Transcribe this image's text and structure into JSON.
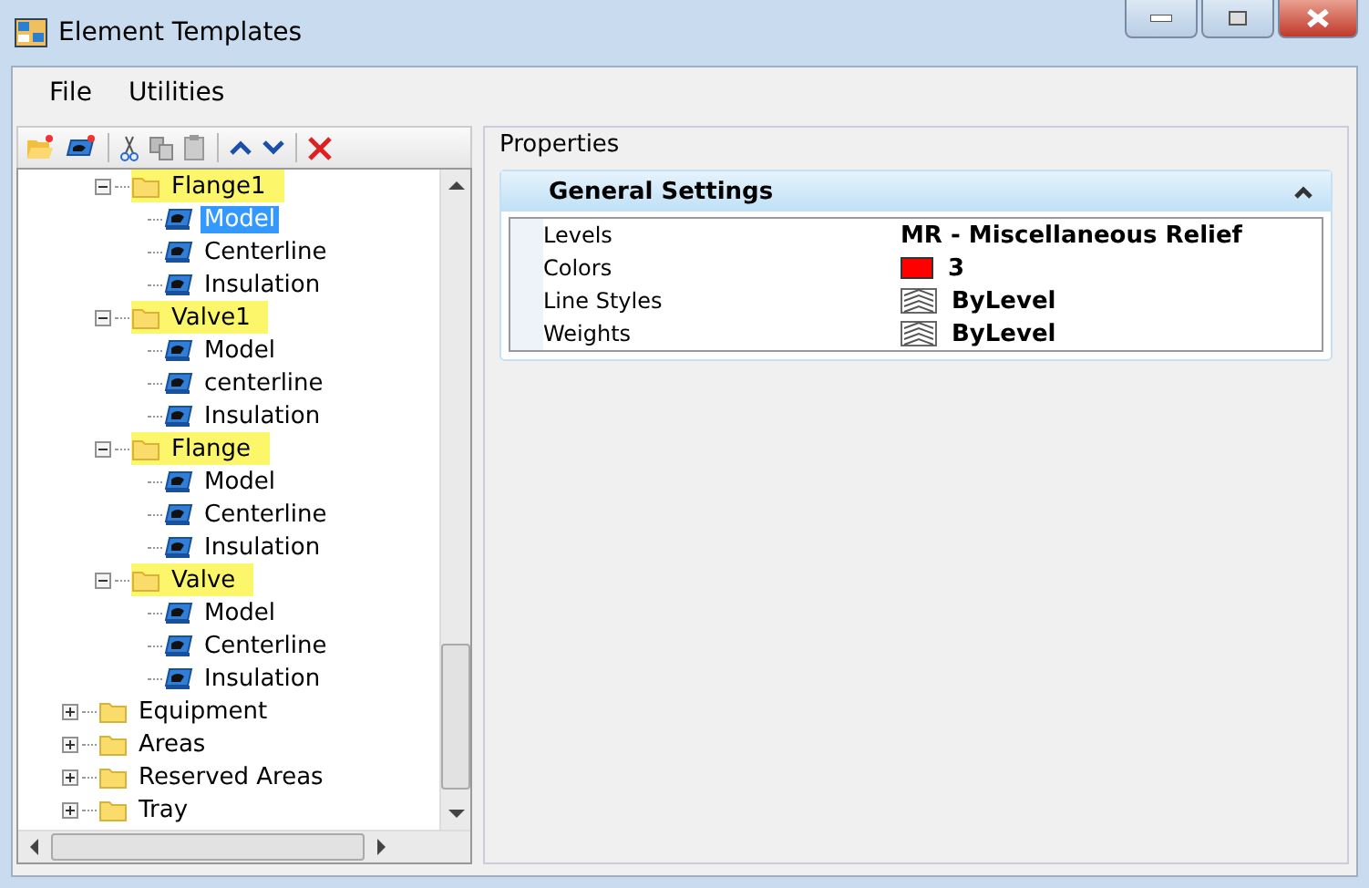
{
  "window": {
    "title": "Element Templates"
  },
  "menu": [
    "File",
    "Utilities"
  ],
  "tree": [
    {
      "children": [
        {
          "kind": "folder",
          "label": "Flange1",
          "highlighted": true,
          "expanded": true,
          "children": [
            {
              "kind": "template",
              "label": "Model",
              "selected": true
            },
            {
              "kind": "template",
              "label": "Centerline",
              "selected": false
            },
            {
              "kind": "template",
              "label": "Insulation",
              "selected": false
            }
          ]
        },
        {
          "kind": "folder",
          "label": "Valve1",
          "highlighted": true,
          "expanded": true,
          "children": [
            {
              "kind": "template",
              "label": "Model",
              "selected": false
            },
            {
              "kind": "template",
              "label": "centerline",
              "selected": false
            },
            {
              "kind": "template",
              "label": "Insulation",
              "selected": false
            }
          ]
        },
        {
          "kind": "folder",
          "label": "Flange",
          "highlighted": true,
          "expanded": true,
          "children": [
            {
              "kind": "template",
              "label": "Model",
              "selected": false
            },
            {
              "kind": "template",
              "label": "Centerline",
              "selected": false
            },
            {
              "kind": "template",
              "label": "Insulation",
              "selected": false
            }
          ]
        },
        {
          "kind": "folder",
          "label": "Valve",
          "highlighted": true,
          "expanded": true,
          "children": [
            {
              "kind": "template",
              "label": "Model",
              "selected": false
            },
            {
              "kind": "template",
              "label": "Centerline",
              "selected": false
            },
            {
              "kind": "template",
              "label": "Insulation",
              "selected": false
            }
          ]
        }
      ]
    },
    {
      "kind": "folder",
      "label": "Equipment",
      "highlighted": false,
      "expanded": false
    },
    {
      "kind": "folder",
      "label": "Areas",
      "highlighted": false,
      "expanded": false
    },
    {
      "kind": "folder",
      "label": "Reserved Areas",
      "highlighted": false,
      "expanded": false
    },
    {
      "kind": "folder",
      "label": "Tray",
      "highlighted": false,
      "expanded": false
    }
  ],
  "properties": {
    "title": "Properties",
    "section": {
      "title": "General Settings",
      "expanded": true,
      "rows": [
        {
          "kind": "text",
          "name": "Levels",
          "value": "MR - Miscellaneous Relief"
        },
        {
          "kind": "color",
          "name": "Colors",
          "value": "3",
          "color": "#ff0000"
        },
        {
          "kind": "style",
          "name": "Line Styles",
          "value": "ByLevel"
        },
        {
          "kind": "style",
          "name": "Weights",
          "value": "ByLevel"
        }
      ]
    }
  }
}
